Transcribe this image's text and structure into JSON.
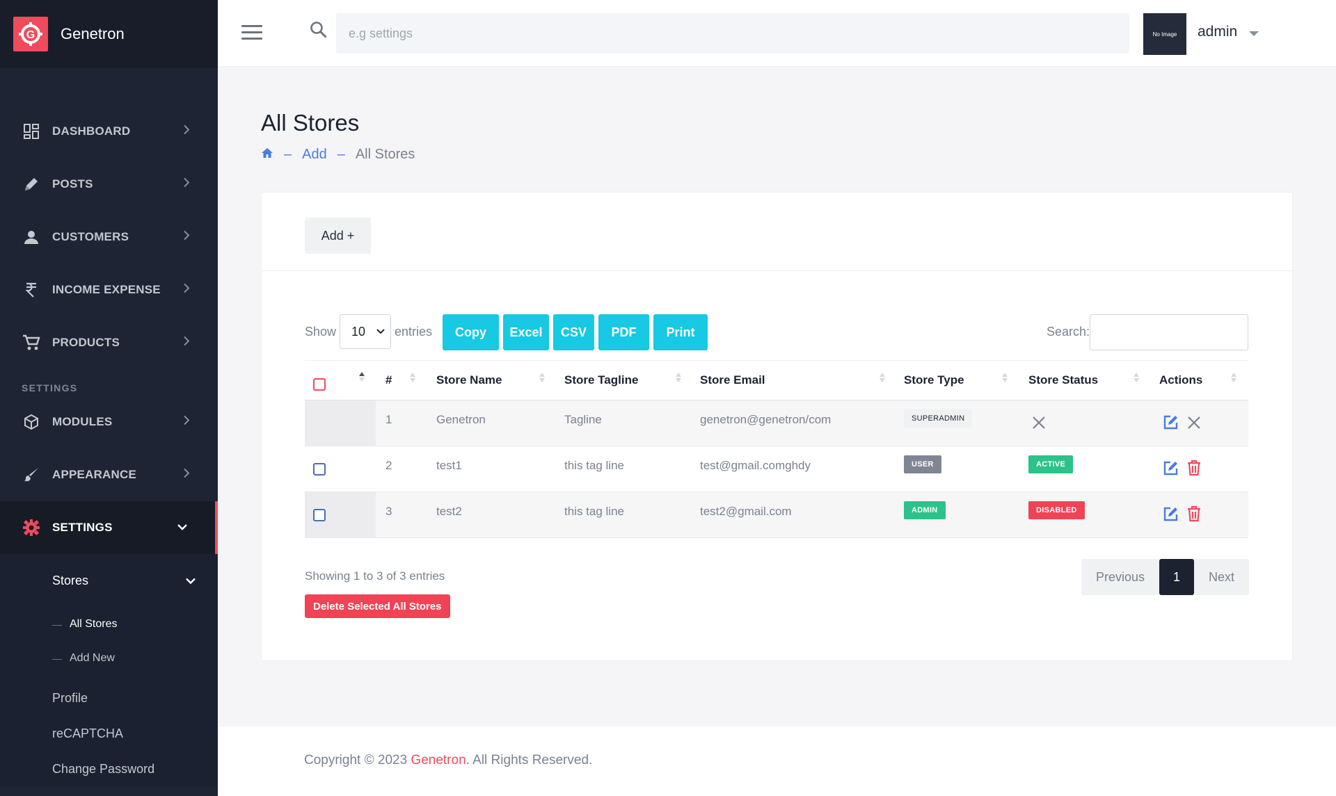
{
  "brand": {
    "name": "Genetron",
    "logo_letter": "G"
  },
  "sidebar": {
    "items": [
      {
        "label": "DASHBOARD",
        "icon": "dashboard-icon"
      },
      {
        "label": "POSTS",
        "icon": "pencil-icon"
      },
      {
        "label": "CUSTOMERS",
        "icon": "person-icon"
      },
      {
        "label": "INCOME EXPENSE",
        "icon": "rupee-icon"
      },
      {
        "label": "PRODUCTS",
        "icon": "cart-icon"
      }
    ],
    "settings_section": "SETTINGS",
    "settings_items": [
      {
        "label": "MODULES",
        "icon": "cube-icon"
      },
      {
        "label": "APPEARANCE",
        "icon": "brush-icon"
      },
      {
        "label": "SETTINGS",
        "icon": "gear-icon"
      }
    ],
    "stores_label": "Stores",
    "stores_children": [
      "All Stores",
      "Add New"
    ],
    "other_items": [
      "Profile",
      "reCAPTCHA",
      "Change Password"
    ]
  },
  "header": {
    "search_placeholder": "e.g settings",
    "avatar_text": "No Image",
    "user_name": "admin"
  },
  "page": {
    "title": "All Stores",
    "breadcrumb": {
      "sep": "–",
      "link": "Add",
      "current": "All Stores"
    }
  },
  "card": {
    "add_label": "Add +",
    "show_label": "Show",
    "entries_value": "10",
    "entries_label": "entries",
    "export_buttons": [
      "Copy",
      "Excel",
      "CSV",
      "PDF",
      "Print"
    ],
    "search_label": "Search:",
    "columns": [
      "#",
      "Store Name",
      "Store Tagline",
      "Store Email",
      "Store Type",
      "Store Status",
      "Actions"
    ],
    "rows": [
      {
        "num": "1",
        "name": "Genetron",
        "tagline": "Tagline",
        "email": "genetron@genetron/com",
        "type": "SUPERADMIN",
        "status": ""
      },
      {
        "num": "2",
        "name": "test1",
        "tagline": "this tag line",
        "email": "test@gmail.comghdy",
        "type": "USER",
        "status": "ACTIVE"
      },
      {
        "num": "3",
        "name": "test2",
        "tagline": "this tag line",
        "email": "test2@gmail.com",
        "type": "ADMIN",
        "status": "DISABLED"
      }
    ],
    "info": "Showing 1 to 3 of 3 entries",
    "delete_label": "Delete Selected All Stores",
    "pager": {
      "prev": "Previous",
      "page": "1",
      "next": "Next"
    }
  },
  "footer": {
    "prefix": "Copyright © 2023 ",
    "brand": "Genetron",
    "suffix": ". All Rights Reserved."
  },
  "colors": {
    "accent": "#ef4b5c",
    "info": "#17c9e2",
    "link": "#4a7be0",
    "sidebar": "#1e2433",
    "success": "#2bc38b",
    "secondary": "#7f8593"
  }
}
